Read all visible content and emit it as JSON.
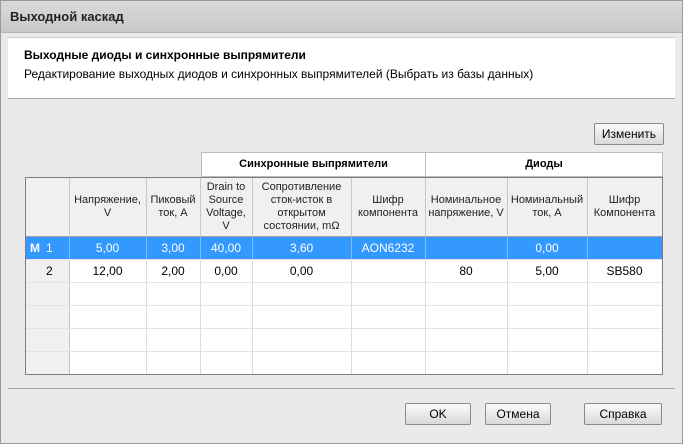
{
  "window": {
    "title": "Выходной каскад"
  },
  "header": {
    "title": "Выходные диоды и синхронные выпрямители",
    "subtitle": "Редактирование выходных диодов и синхронных выпрямителей (Выбрать из базы данных)"
  },
  "toolbar": {
    "change_label": "Изменить"
  },
  "groups": {
    "sync": "Синхронные выпрямители",
    "diodes": "Диоды"
  },
  "columns": [
    "",
    "Напряжение, V",
    "Пиковый ток, А",
    "Drain to Source Voltage, V",
    "Сопротивление сток-исток в открытом состоянии, mΩ",
    "Шифр компонента",
    "Номинальное напряжение, V",
    "Номинальный ток, А",
    "Шифр Компонента"
  ],
  "rows": [
    {
      "mark": "M",
      "index": "1",
      "cells": [
        "5,00",
        "3,00",
        "40,00",
        "3,60",
        "AON6232",
        "",
        "0,00",
        ""
      ]
    },
    {
      "mark": "",
      "index": "2",
      "cells": [
        "12,00",
        "2,00",
        "0,00",
        "0,00",
        "",
        "80",
        "5,00",
        "SB580"
      ]
    }
  ],
  "footer": {
    "ok_label": "OK",
    "cancel_label": "Отмена",
    "help_label": "Справка"
  },
  "colors": {
    "selection": "#3399ff"
  }
}
